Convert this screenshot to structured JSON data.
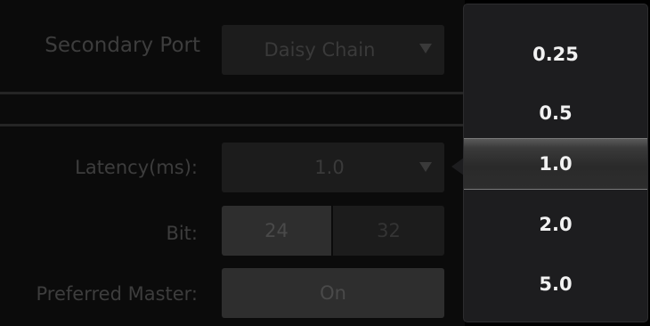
{
  "secondary_port": {
    "label": "Secondary Port",
    "value": "Daisy Chain"
  },
  "latency": {
    "label": "Latency(ms):",
    "value": "1.0"
  },
  "bit": {
    "label": "Bit:",
    "options": [
      "24",
      "32"
    ],
    "selected": "24"
  },
  "preferred_master": {
    "label": "Preferred Master:",
    "value": "On"
  },
  "latency_dropdown": {
    "options": [
      "0.25",
      "0.5",
      "1.0",
      "2.0",
      "5.0"
    ],
    "selected": "1.0"
  }
}
